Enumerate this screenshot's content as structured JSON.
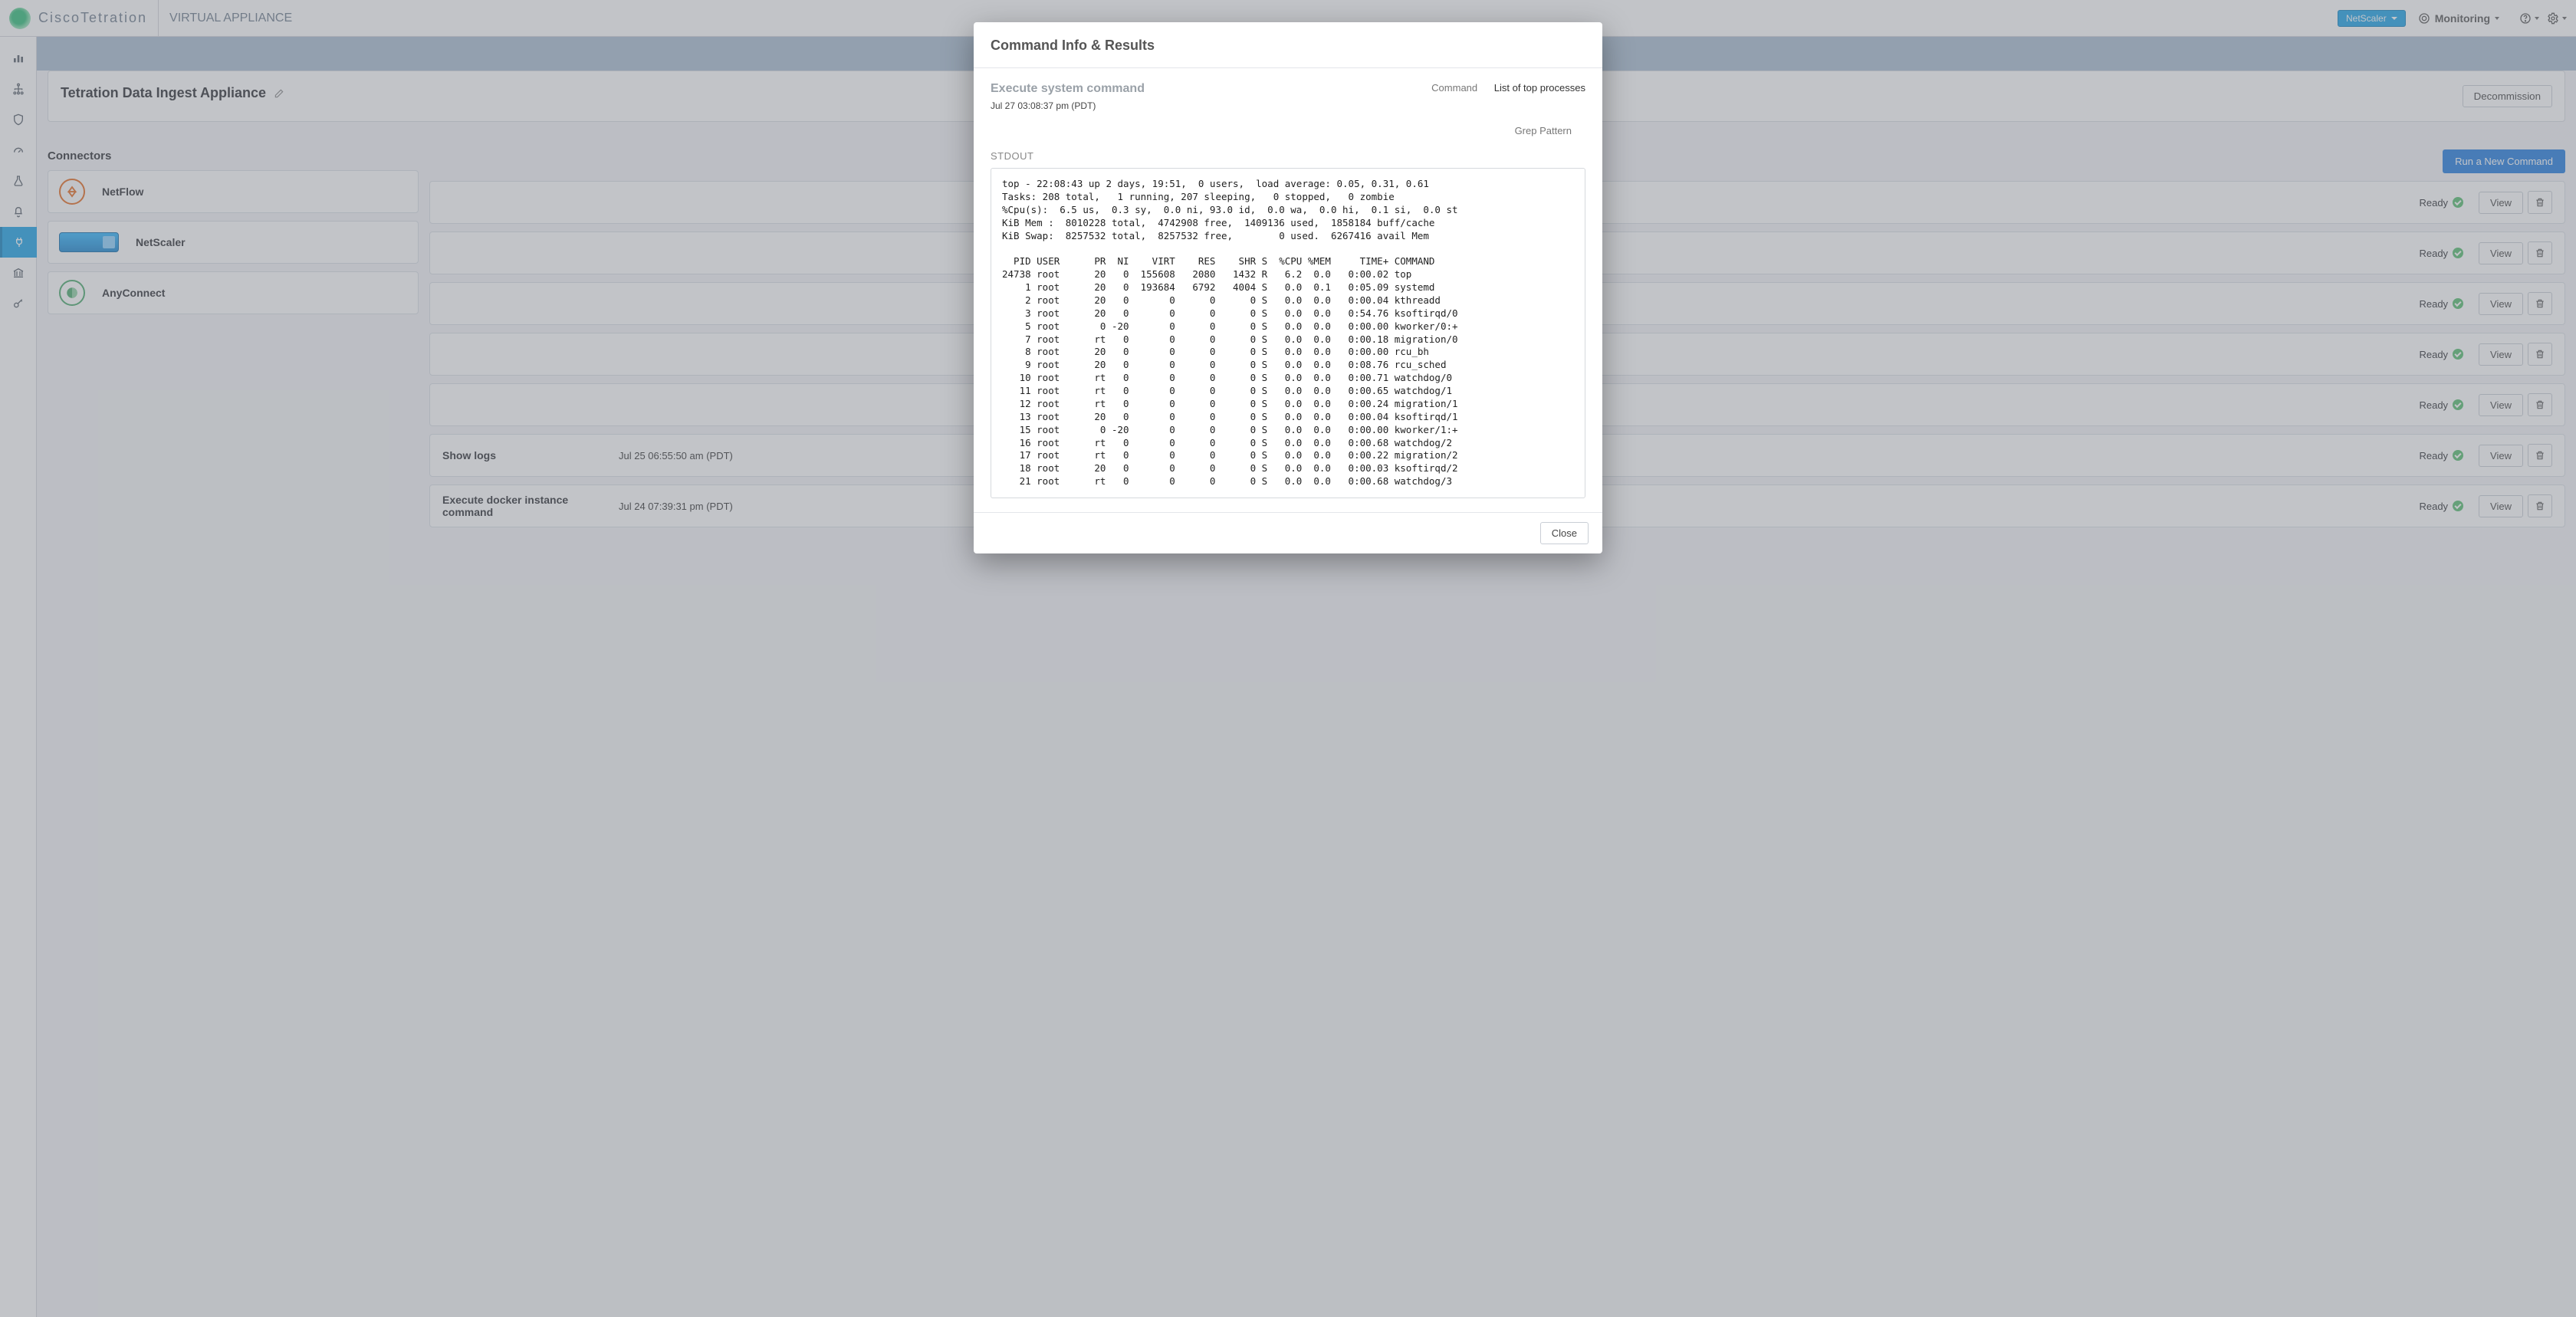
{
  "header": {
    "brand": "CiscoTetration",
    "sublabel": "VIRTUAL APPLIANCE",
    "tenant": "NetScaler",
    "monitoring": "Monitoring"
  },
  "appliance": {
    "title": "Tetration Data Ingest Appliance",
    "decommission": "Decommission"
  },
  "connectors": {
    "heading": "Connectors",
    "items": [
      {
        "name": "NetFlow"
      },
      {
        "name": "NetScaler"
      },
      {
        "name": "AnyConnect"
      }
    ]
  },
  "commands": {
    "run_label": "Run a New Command",
    "view_label": "View",
    "status_label": "Ready",
    "rows": [
      {
        "name": "",
        "time": ""
      },
      {
        "name": "",
        "time": ""
      },
      {
        "name": "",
        "time": ""
      },
      {
        "name": "",
        "time": ""
      },
      {
        "name": "",
        "time": ""
      },
      {
        "name": "Show logs",
        "time": "Jul 25 06:55:50 am (PDT)"
      },
      {
        "name": "Execute docker instance command",
        "time": "Jul 24 07:39:31 pm (PDT)"
      }
    ]
  },
  "modal": {
    "title": "Command Info & Results",
    "subtitle": "Execute system command",
    "timestamp": "Jul 27 03:08:37 pm (PDT)",
    "command_label": "Command",
    "command_value": "List of top processes",
    "grep_label": "Grep Pattern",
    "stdout_label": "STDOUT",
    "close_label": "Close",
    "stdout": "top - 22:08:43 up 2 days, 19:51,  0 users,  load average: 0.05, 0.31, 0.61\nTasks: 208 total,   1 running, 207 sleeping,   0 stopped,   0 zombie\n%Cpu(s):  6.5 us,  0.3 sy,  0.0 ni, 93.0 id,  0.0 wa,  0.0 hi,  0.1 si,  0.0 st\nKiB Mem :  8010228 total,  4742908 free,  1409136 used,  1858184 buff/cache\nKiB Swap:  8257532 total,  8257532 free,        0 used.  6267416 avail Mem\n\n  PID USER      PR  NI    VIRT    RES    SHR S  %CPU %MEM     TIME+ COMMAND\n24738 root      20   0  155608   2080   1432 R   6.2  0.0   0:00.02 top\n    1 root      20   0  193684   6792   4004 S   0.0  0.1   0:05.09 systemd\n    2 root      20   0       0      0      0 S   0.0  0.0   0:00.04 kthreadd\n    3 root      20   0       0      0      0 S   0.0  0.0   0:54.76 ksoftirqd/0\n    5 root       0 -20       0      0      0 S   0.0  0.0   0:00.00 kworker/0:+\n    7 root      rt   0       0      0      0 S   0.0  0.0   0:00.18 migration/0\n    8 root      20   0       0      0      0 S   0.0  0.0   0:00.00 rcu_bh\n    9 root      20   0       0      0      0 S   0.0  0.0   0:08.76 rcu_sched\n   10 root      rt   0       0      0      0 S   0.0  0.0   0:00.71 watchdog/0\n   11 root      rt   0       0      0      0 S   0.0  0.0   0:00.65 watchdog/1\n   12 root      rt   0       0      0      0 S   0.0  0.0   0:00.24 migration/1\n   13 root      20   0       0      0      0 S   0.0  0.0   0:00.04 ksoftirqd/1\n   15 root       0 -20       0      0      0 S   0.0  0.0   0:00.00 kworker/1:+\n   16 root      rt   0       0      0      0 S   0.0  0.0   0:00.68 watchdog/2\n   17 root      rt   0       0      0      0 S   0.0  0.0   0:00.22 migration/2\n   18 root      20   0       0      0      0 S   0.0  0.0   0:00.03 ksoftirqd/2\n   21 root      rt   0       0      0      0 S   0.0  0.0   0:00.68 watchdog/3"
  }
}
